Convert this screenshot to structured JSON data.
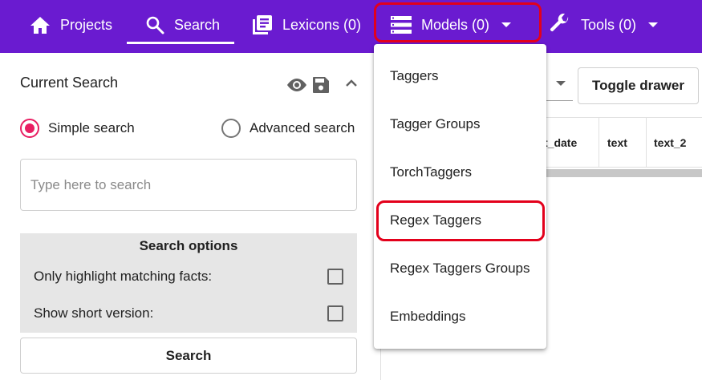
{
  "nav": {
    "projects_label": "Projects",
    "search_label": "Search",
    "lexicons_label": "Lexicons (0)",
    "models_label": "Models (0)",
    "tools_label": "Tools (0)"
  },
  "models_menu": {
    "items": [
      {
        "label": "Taggers"
      },
      {
        "label": "Tagger Groups"
      },
      {
        "label": "TorchTaggers"
      },
      {
        "label": "Regex Taggers"
      },
      {
        "label": "Regex Taggers Groups"
      },
      {
        "label": "Embeddings"
      }
    ]
  },
  "search_panel": {
    "title": "Current Search",
    "simple_search_label": "Simple search",
    "advanced_search_label": "Advanced search",
    "search_placeholder": "Type here to search",
    "search_value": "",
    "options_title": "Search options",
    "option_highlight_label": "Only highlight matching facts:",
    "option_short_label": "Show short version:",
    "search_button_label": "Search"
  },
  "results": {
    "toggle_drawer_label": "Toggle drawer",
    "columns": [
      "t_date",
      "text",
      "text_2"
    ]
  },
  "colors": {
    "topbar": "#6a1bd0",
    "radio_selected": "#e91e63",
    "highlight": "#e3001b"
  }
}
